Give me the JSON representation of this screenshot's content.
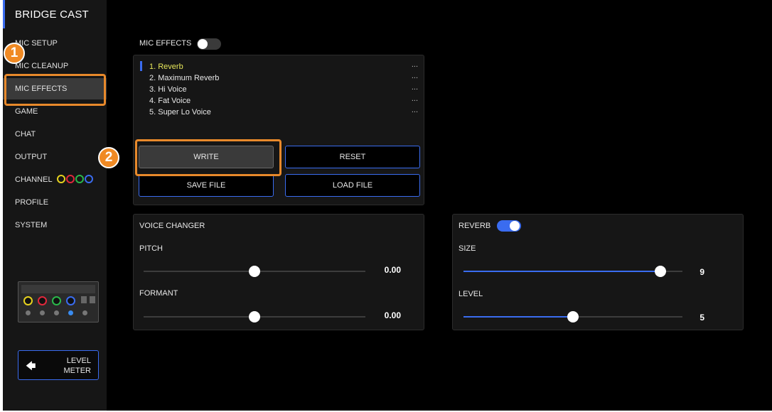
{
  "sidebar": {
    "brand": "BRIDGE CAST",
    "items": [
      {
        "label": "MIC SETUP",
        "name": "sidebar-item-mic-setup"
      },
      {
        "label": "MIC CLEANUP",
        "name": "sidebar-item-mic-cleanup"
      },
      {
        "label": "MIC EFFECTS",
        "name": "sidebar-item-mic-effects"
      },
      {
        "label": "GAME",
        "name": "sidebar-item-game"
      },
      {
        "label": "CHAT",
        "name": "sidebar-item-chat"
      },
      {
        "label": "OUTPUT",
        "name": "sidebar-item-output"
      },
      {
        "label": "CHANNEL",
        "name": "sidebar-item-channel"
      },
      {
        "label": "PROFILE",
        "name": "sidebar-item-profile"
      },
      {
        "label": "SYSTEM",
        "name": "sidebar-item-system"
      }
    ],
    "channel_colors": [
      "#e6d21e",
      "#e0283c",
      "#2ab84a",
      "#3a6cf0"
    ],
    "level_meter": {
      "line1": "LEVEL",
      "line2": "METER"
    }
  },
  "mic_effects": {
    "label": "MIC EFFECTS",
    "enabled": false,
    "presets": [
      {
        "label": "1. Reverb",
        "more": "...",
        "selected": true
      },
      {
        "label": "2. Maximum Reverb",
        "more": "..."
      },
      {
        "label": "3. Hi Voice",
        "more": "..."
      },
      {
        "label": "4. Fat Voice",
        "more": "..."
      },
      {
        "label": "5. Super Lo Voice",
        "more": "..."
      }
    ],
    "buttons": {
      "write": "WRITE",
      "reset": "RESET",
      "save": "SAVE FILE",
      "load": "LOAD FILE"
    }
  },
  "voice_changer": {
    "title": "VOICE CHANGER",
    "pitch": {
      "label": "PITCH",
      "value": "0.00",
      "position": 0.5
    },
    "formant": {
      "label": "FORMANT",
      "value": "0.00",
      "position": 0.5
    }
  },
  "reverb": {
    "title": "REVERB",
    "enabled": true,
    "size": {
      "label": "SIZE",
      "value": "9",
      "position": 0.9
    },
    "level": {
      "label": "LEVEL",
      "value": "5",
      "position": 0.5
    }
  },
  "annotations": {
    "step1": "1",
    "step2": "2"
  },
  "colors": {
    "accent": "#3a6cf0",
    "highlight": "#e8892b",
    "selected_text": "#e6e65a"
  }
}
